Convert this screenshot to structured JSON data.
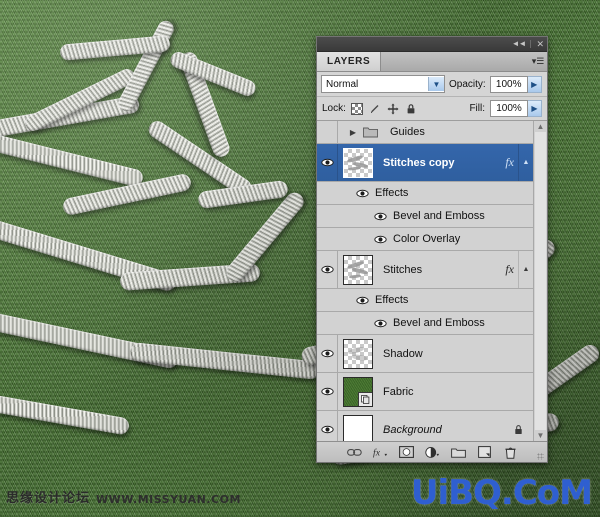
{
  "panel": {
    "titlebar": {
      "collapse_icon": "collapse-to-icons-icon",
      "close_icon": "close-icon"
    },
    "tab_label": "LAYERS",
    "menu_icon": "panel-menu-icon",
    "blend_mode": "Normal",
    "opacity_label": "Opacity:",
    "opacity_value": "100%",
    "lock_label": "Lock:",
    "lock_icons": [
      "lock-transparency-icon",
      "lock-image-pixels-icon",
      "lock-position-icon",
      "lock-all-icon"
    ],
    "fill_label": "Fill:",
    "fill_value": "100%",
    "layers": [
      {
        "name": "Guides",
        "type": "group",
        "visible": false,
        "expanded": false,
        "italic": false,
        "has_fx": false,
        "locked": false
      },
      {
        "name": "Stitches copy",
        "type": "layer",
        "visible": true,
        "selected": true,
        "italic": false,
        "has_fx": true,
        "locked": false,
        "thumb": "transparent-stitches",
        "effects_label": "Effects",
        "effects": [
          "Bevel and Emboss",
          "Color Overlay"
        ]
      },
      {
        "name": "Stitches",
        "type": "layer",
        "visible": true,
        "selected": false,
        "italic": false,
        "has_fx": true,
        "locked": false,
        "thumb": "transparent-stitches",
        "effects_label": "Effects",
        "effects": [
          "Bevel and Emboss"
        ]
      },
      {
        "name": "Shadow",
        "type": "layer",
        "visible": true,
        "selected": false,
        "italic": false,
        "has_fx": false,
        "locked": false,
        "thumb": "transparent-stitches",
        "effects": []
      },
      {
        "name": "Fabric",
        "type": "layer",
        "visible": true,
        "selected": false,
        "italic": false,
        "has_fx": false,
        "locked": false,
        "thumb": "green-fabric-smartobject",
        "effects": []
      },
      {
        "name": "Background",
        "type": "layer",
        "visible": true,
        "selected": false,
        "italic": true,
        "has_fx": false,
        "locked": true,
        "thumb": "white-solid",
        "effects": []
      }
    ],
    "scrollbar": {
      "up_icon": "scroll-up-icon",
      "down_icon": "scroll-down-icon"
    },
    "bottom_buttons": [
      "link-layers-icon",
      "add-layer-style-icon",
      "add-layer-mask-icon",
      "new-fill-adjustment-layer-icon",
      "new-group-icon",
      "new-layer-icon",
      "delete-layer-icon"
    ]
  },
  "watermark": {
    "site_cn": "思缘设计论坛",
    "site_url": "WWW.MISSYUAN.COM",
    "brand": "UiBQ.CoM",
    "brand_color": "#2f5fd0"
  },
  "canvas": {
    "description": "green-woven-fabric-with-gray-embroidered-stitched-lettering",
    "fabric_color": "#4a7a33",
    "stitch_color": "#c9ccc4"
  }
}
